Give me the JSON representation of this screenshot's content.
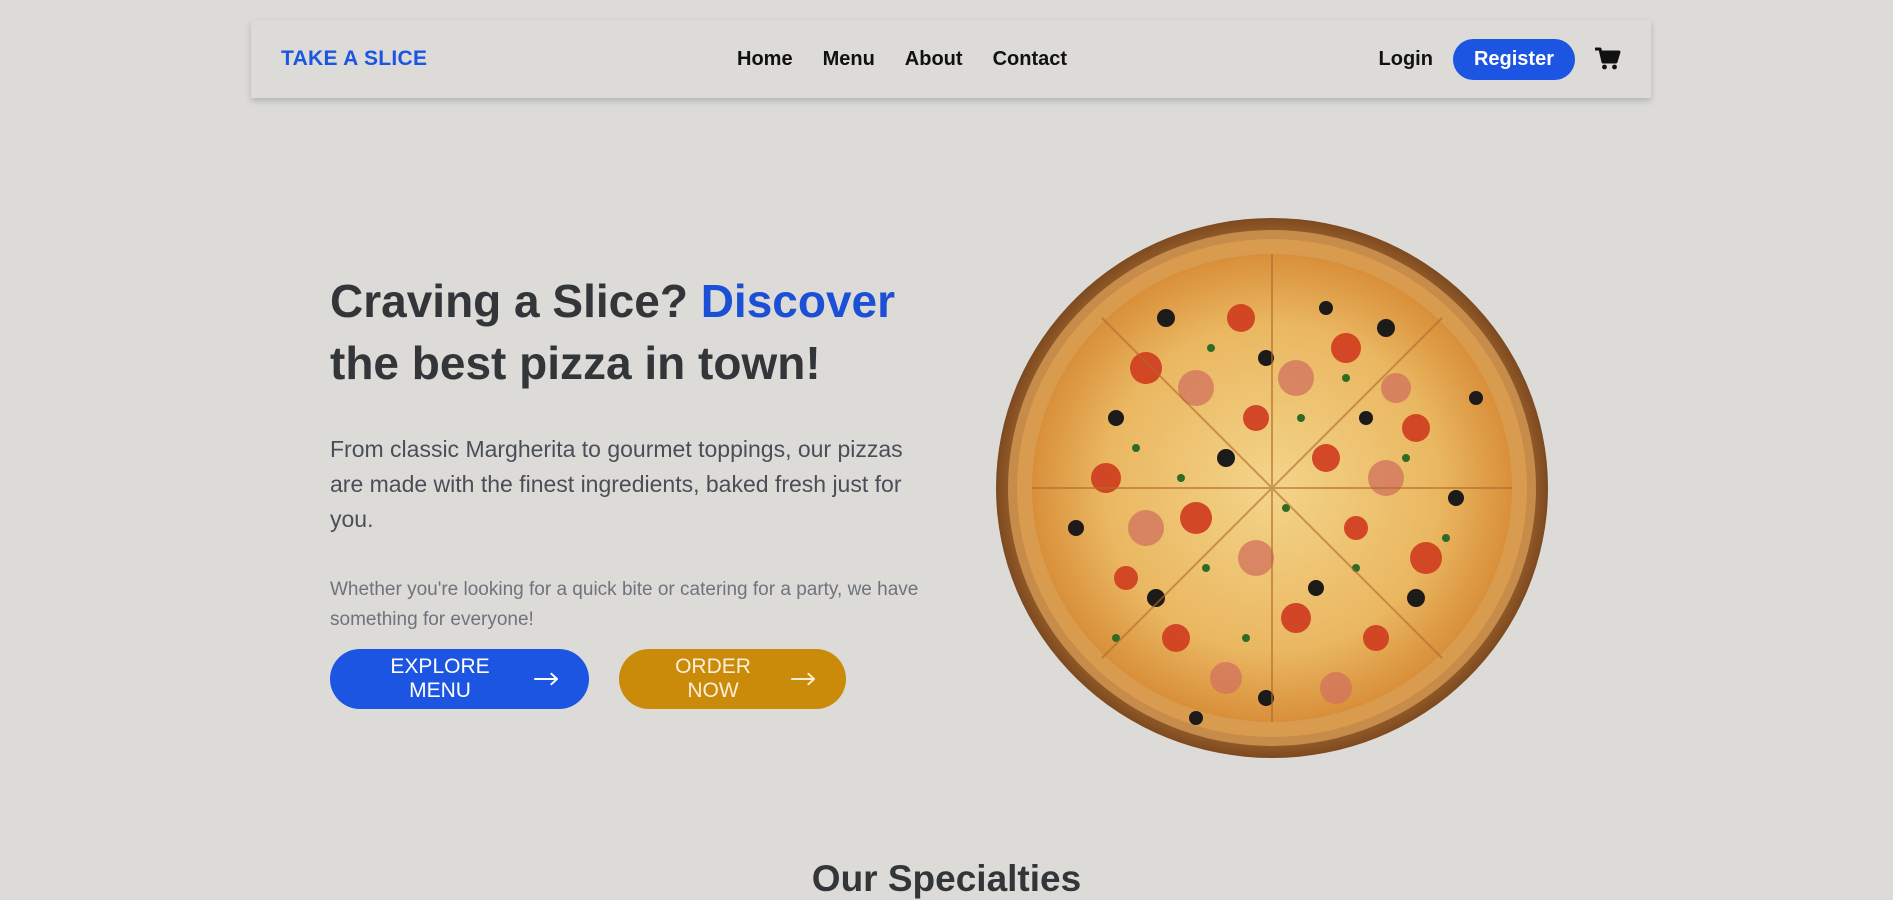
{
  "brand": {
    "name": "TAKE A SLICE",
    "color": "#1b55e2"
  },
  "nav": {
    "links": [
      "Home",
      "Menu",
      "About",
      "Contact"
    ],
    "login": "Login",
    "register": "Register",
    "cart_icon": "shopping-cart-icon"
  },
  "hero": {
    "title_start": "Craving a Slice?",
    "title_accent": "Discover",
    "title_end": "the best pizza in town!",
    "description": "From classic Margherita to gourmet toppings, our pizzas are made with the finest ingredients, baked fresh just for you.",
    "subtext": "Whether you're looking for a quick bite or catering for a party, we have something for everyone!",
    "explore_button": "EXPLORE MENU",
    "order_button": "ORDER NOW",
    "arrow_icon": "arrow-right-icon"
  },
  "specialties": {
    "title": "Our Specialties"
  },
  "colors": {
    "background": "#dcdbd8",
    "primary": "#1b55e2",
    "secondary": "#ca8b0b",
    "text": "#333638"
  }
}
